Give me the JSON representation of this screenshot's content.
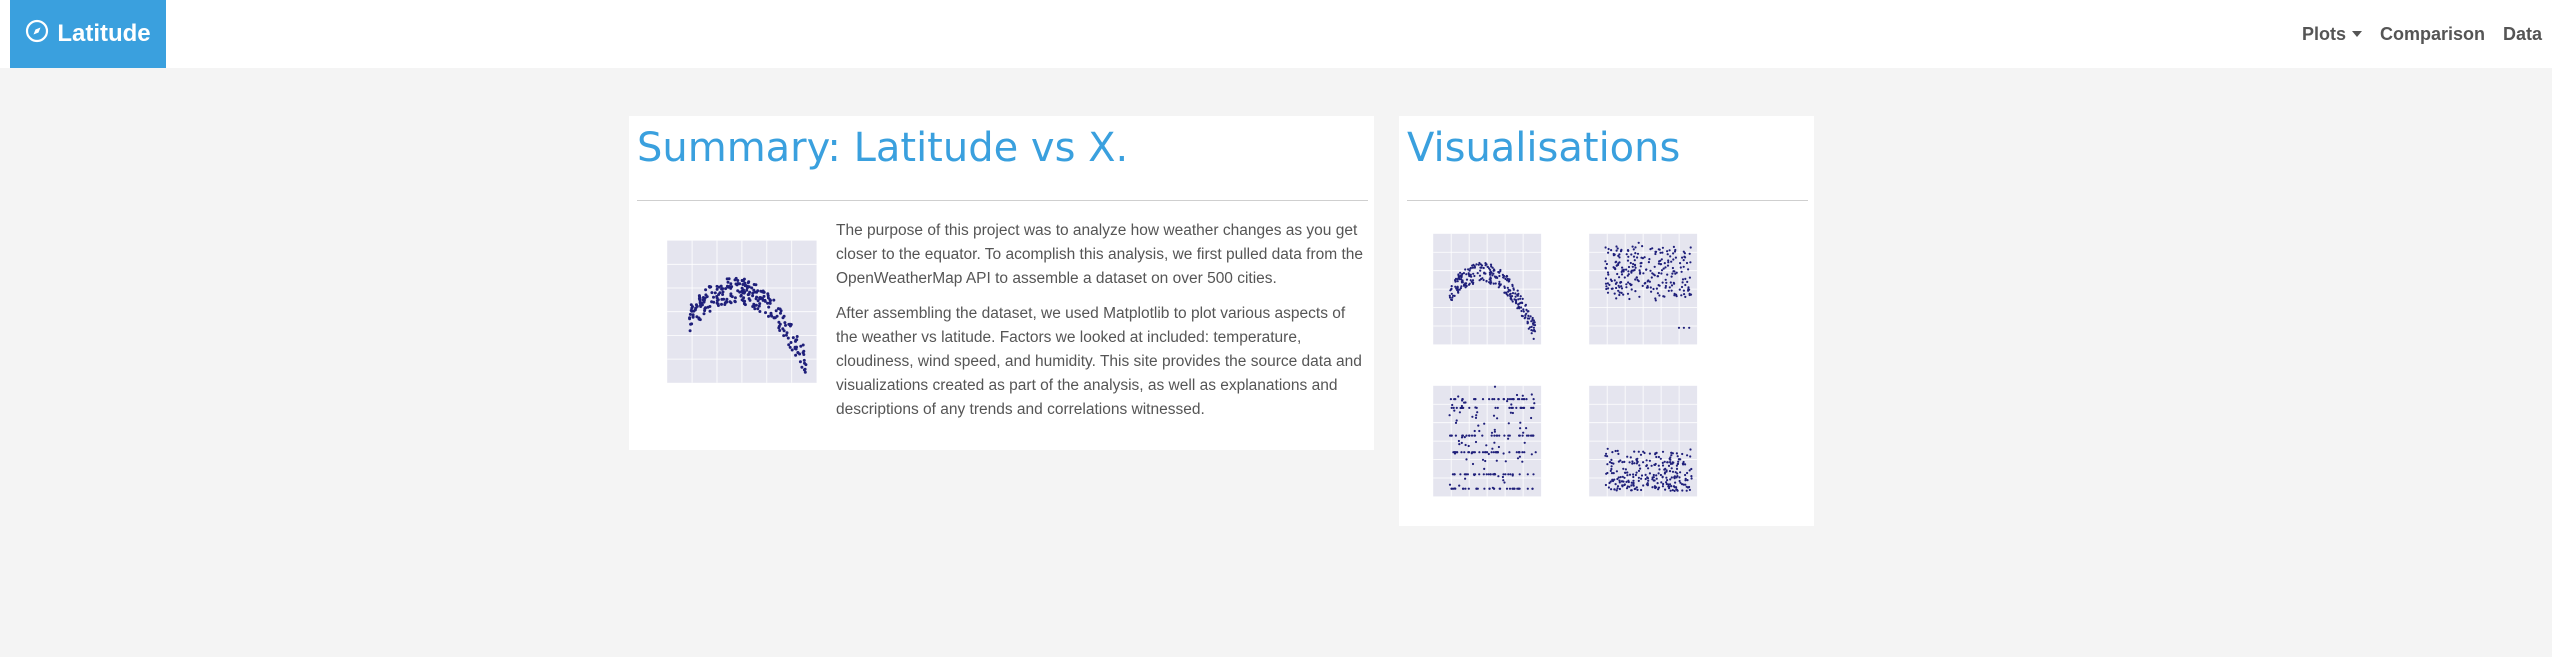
{
  "navbar": {
    "brand_label": "Latitude",
    "items": [
      {
        "label": "Plots",
        "has_dropdown": true
      },
      {
        "label": "Comparison"
      },
      {
        "label": "Data"
      }
    ]
  },
  "summary": {
    "title": "Summary: Latitude vs X.",
    "paragraphs": [
      "The purpose of this project was to analyze how weather changes as you get closer to the equator. To acomplish this analysis, we first pulled data from the OpenWeatherMap API to assemble a dataset on over 500 cities.",
      "After assembling the dataset, we used Matplotlib to plot various aspects of the weather vs latitude. Factors we looked at included: temperature, cloudiness, wind speed, and humidity. This site provides the source data and visualizations created as part of the analysis, as well as explanations and descriptions of any trends and correlations witnessed."
    ]
  },
  "visualisations": {
    "title": "Visualisations",
    "thumbnails": [
      {
        "icon": "scatter-plot-temperature"
      },
      {
        "icon": "scatter-plot-humidity"
      },
      {
        "icon": "scatter-plot-cloudiness"
      },
      {
        "icon": "scatter-plot-wind-speed"
      }
    ]
  },
  "colors": {
    "accent": "#3aa0de",
    "background": "#f4f4f4",
    "plot_bg": "#e5e5ef",
    "points": "#1f1f7a"
  }
}
